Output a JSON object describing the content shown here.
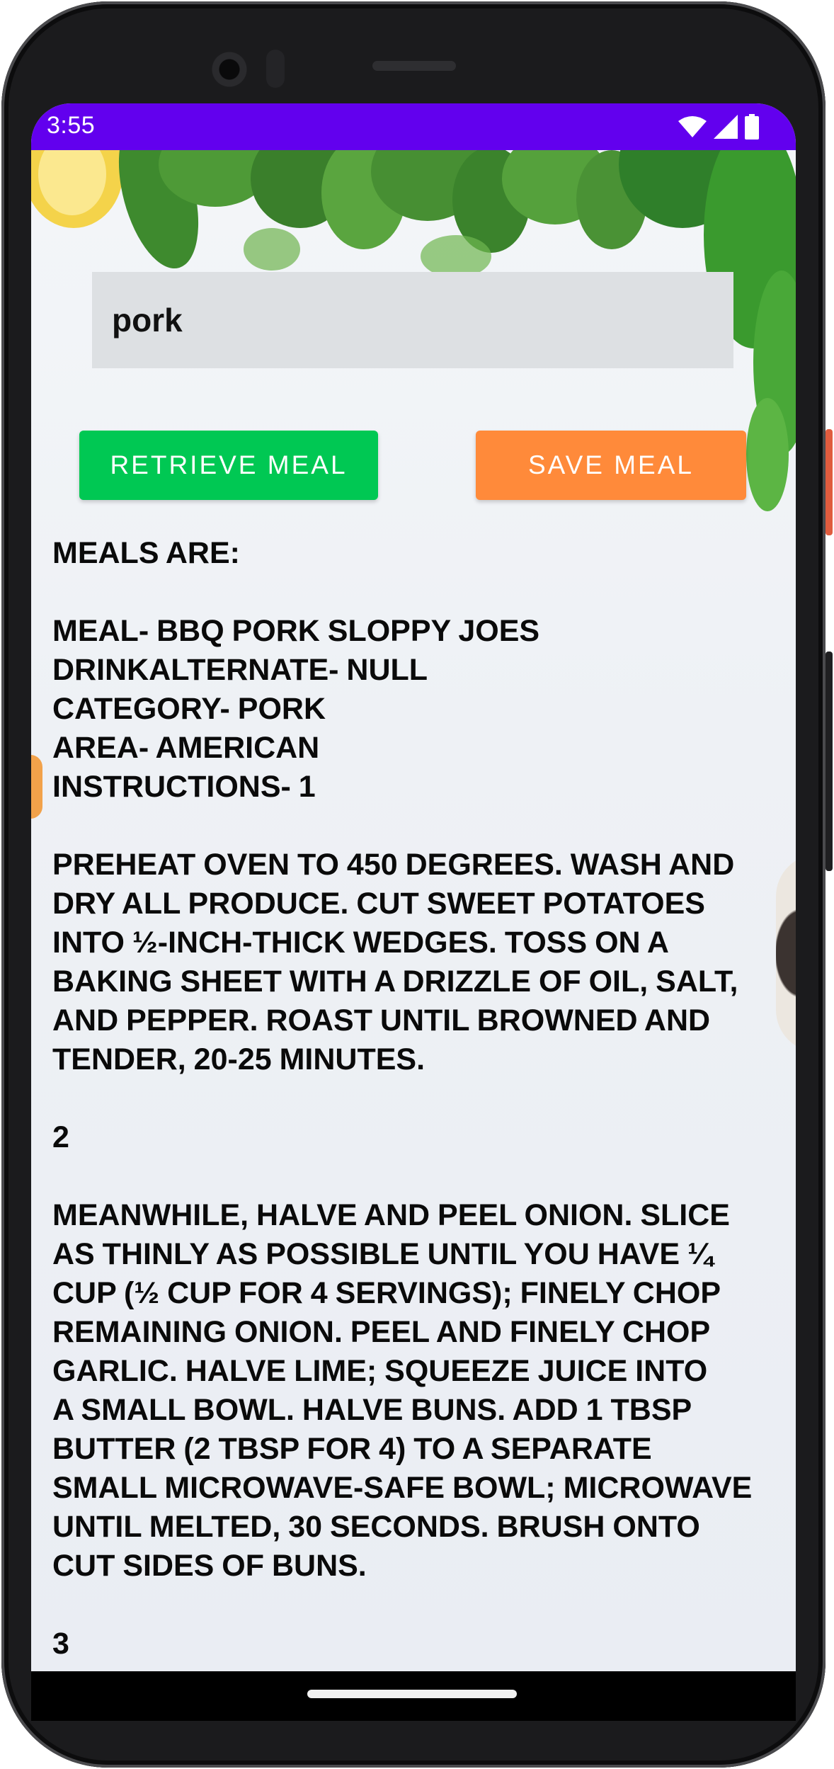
{
  "status_bar": {
    "time": "3:55",
    "icons": [
      "wifi-icon",
      "cell-signal-icon",
      "battery-icon"
    ],
    "color": "#6200ee"
  },
  "search": {
    "value": "pork"
  },
  "buttons": {
    "retrieve_label": "RETRIEVE MEAL",
    "save_label": "SAVE MEAL",
    "retrieve_color": "#00c853",
    "save_color": "#ff8a3a"
  },
  "result": {
    "text": "MEALS ARE:\n\nMEAL- BBQ PORK SLOPPY JOES\nDRINKALTERNATE- NULL\nCATEGORY- PORK\nAREA- AMERICAN\nINSTRUCTIONS- 1\n\nPREHEAT OVEN TO 450 DEGREES. WASH AND\nDRY ALL PRODUCE. CUT SWEET POTATOES\nINTO ½-INCH-THICK WEDGES. TOSS ON A\nBAKING SHEET WITH A DRIZZLE OF OIL, SALT,\nAND PEPPER. ROAST UNTIL BROWNED AND\nTENDER, 20-25 MINUTES.\n\n2\n\nMEANWHILE, HALVE AND PEEL ONION. SLICE\nAS THINLY AS POSSIBLE UNTIL YOU HAVE ¼\nCUP (½ CUP FOR 4 SERVINGS); FINELY CHOP\nREMAINING ONION. PEEL AND FINELY CHOP\nGARLIC. HALVE LIME; SQUEEZE JUICE INTO\nA SMALL BOWL. HALVE BUNS. ADD 1 TBSP\nBUTTER (2 TBSP FOR 4) TO A SEPARATE\nSMALL MICROWAVE-SAFE BOWL; MICROWAVE\nUNTIL MELTED, 30 SECONDS. BRUSH ONTO\nCUT SIDES OF BUNS.\n\n3"
  }
}
